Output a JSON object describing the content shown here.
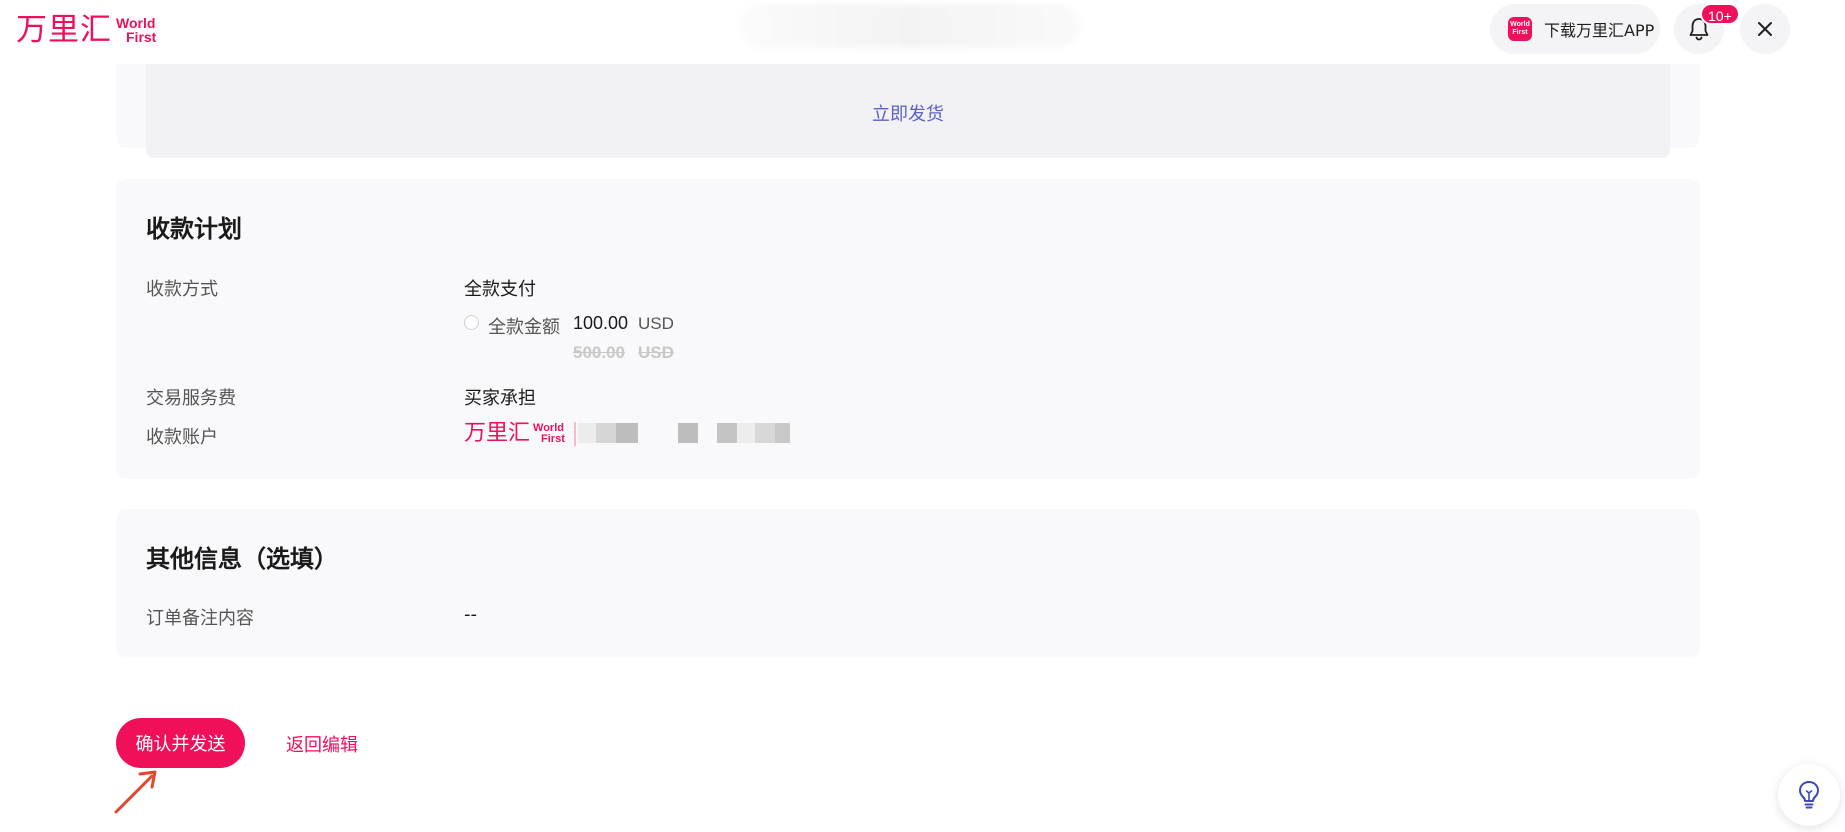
{
  "header": {
    "logo_cn": "万里汇",
    "logo_en_line1": "World",
    "logo_en_line2": "First",
    "app_icon_line1": "World",
    "app_icon_line2": "First",
    "download_label": "下载万里汇APP",
    "notification_badge": "10+"
  },
  "shipping": {
    "ship_now_link": "立即发货"
  },
  "payment_plan": {
    "title": "收款计划",
    "method_label": "收款方式",
    "method_value": "全款支付",
    "full_amount_label": "全款金额",
    "amount": "100.00",
    "currency": "USD",
    "original_amount": "500.00",
    "original_currency": "USD",
    "service_fee_label": "交易服务费",
    "service_fee_value": "买家承担",
    "account_label": "收款账户",
    "account_logo_cn": "万里汇",
    "account_logo_en1": "World",
    "account_logo_en2": "First"
  },
  "other_info": {
    "title": "其他信息（选填）",
    "remark_label": "订单备注内容",
    "remark_value": "--"
  },
  "actions": {
    "confirm_label": "确认并发送",
    "back_label": "返回编辑"
  },
  "colors": {
    "brand": "#f0105a",
    "link": "#5a62c4"
  }
}
